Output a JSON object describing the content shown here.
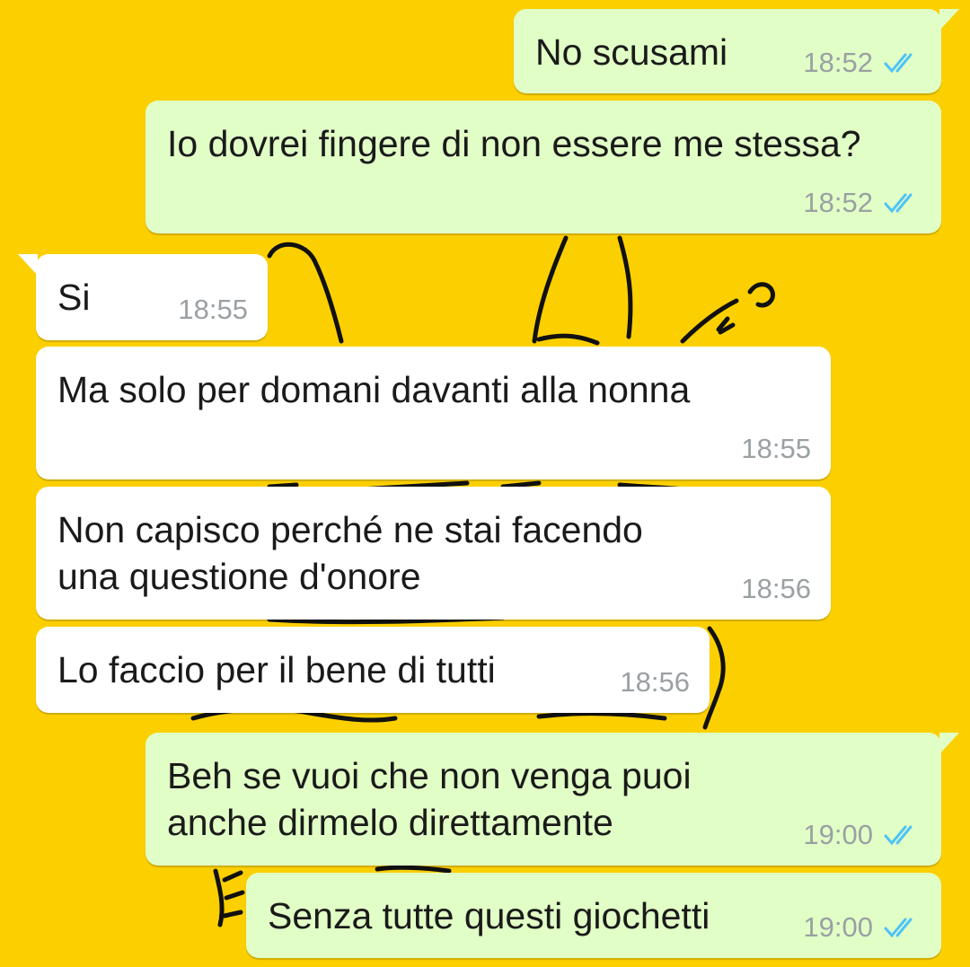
{
  "theme": {
    "background": "#fcd000",
    "outgoing_bubble": "#e1fec6",
    "incoming_bubble": "#ffffff",
    "read_ticks": "#4fc3f7",
    "timestamp_text": "#9aa0a3"
  },
  "messages": [
    {
      "direction": "out",
      "text": "No scusami",
      "time": "18:52",
      "status_icon": "double-check-read-icon"
    },
    {
      "direction": "out",
      "text": "Io dovrei fingere di non essere me stessa?",
      "time": "18:52",
      "status_icon": "double-check-read-icon"
    },
    {
      "direction": "in",
      "text": "Si",
      "time": "18:55"
    },
    {
      "direction": "in",
      "text": "Ma solo per domani davanti alla nonna",
      "time": "18:55"
    },
    {
      "direction": "in",
      "text": "Non capisco perché ne stai facendo una questione d'onore",
      "time": "18:56"
    },
    {
      "direction": "in",
      "text": "Lo faccio per il bene di tutti",
      "time": "18:56"
    },
    {
      "direction": "out",
      "text": "Beh se vuoi che non venga puoi anche dirmelo direttamente",
      "time": "19:00",
      "status_icon": "double-check-read-icon"
    },
    {
      "direction": "out",
      "text": "Senza tutte questi giochetti",
      "time": "19:00",
      "status_icon": "double-check-read-icon"
    }
  ]
}
